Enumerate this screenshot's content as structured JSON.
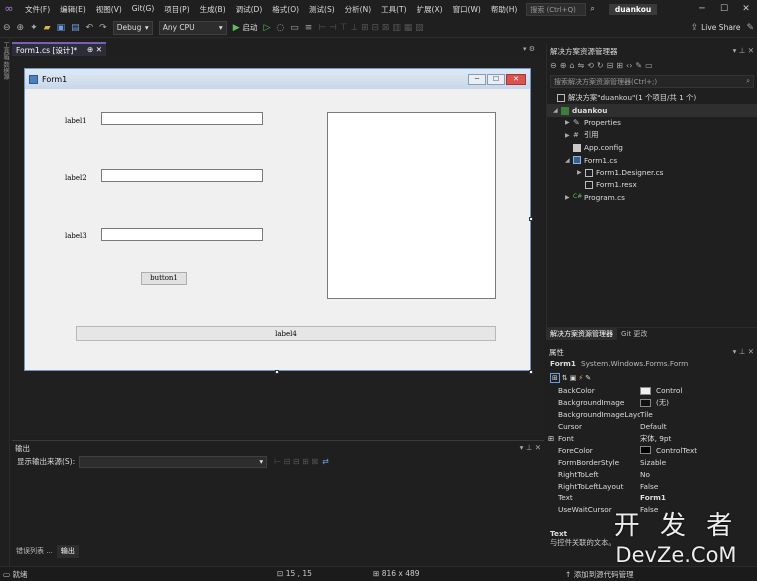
{
  "menu": {
    "items": [
      "文件(F)",
      "编辑(E)",
      "视图(V)",
      "Git(G)",
      "项目(P)",
      "生成(B)",
      "调试(D)",
      "格式(O)",
      "测试(S)",
      "分析(N)",
      "工具(T)",
      "扩展(X)",
      "窗口(W)",
      "帮助(H)"
    ],
    "search_placeholder": "搜索 (Ctrl+Q)",
    "project_name": "duankou"
  },
  "toolbar": {
    "config": "Debug",
    "platform": "Any CPU",
    "start_label": "启动",
    "live_share": "Live Share"
  },
  "doc_tab": {
    "title": "Form1.cs [设计]*",
    "pin": "⊕",
    "close": "✕"
  },
  "form": {
    "title": "Form1",
    "label1": "label1",
    "label2": "label2",
    "label3": "label3",
    "button1": "button1",
    "label4": "label4"
  },
  "output": {
    "title": "输出",
    "source_label": "显示输出来源(S):",
    "tabs": [
      "错误列表 ...",
      "输出"
    ]
  },
  "solution": {
    "title": "解决方案资源管理器",
    "search_placeholder": "搜索解决方案资源管理器(Ctrl+;)",
    "items": [
      "解决方案\"duankou\"(1 个项目/共 1 个)",
      "duankou",
      "Properties",
      "引用",
      "App.config",
      "Form1.cs",
      "Form1.Designer.cs",
      "Form1.resx",
      "Program.cs"
    ],
    "tabs": [
      "解决方案资源管理器",
      "Git 更改"
    ]
  },
  "properties": {
    "title": "属性",
    "object_name": "Form1",
    "object_type": "System.Windows.Forms.Form",
    "rows": [
      {
        "name": "BackColor",
        "value": "Control",
        "swatch": "#f0f0f0"
      },
      {
        "name": "BackgroundImage",
        "value": "(无)",
        "swatch": "#111111"
      },
      {
        "name": "BackgroundImageLayout",
        "value": "Tile"
      },
      {
        "name": "Cursor",
        "value": "Default"
      },
      {
        "name": "Font",
        "value": "宋体, 9pt",
        "expand": "⊞"
      },
      {
        "name": "ForeColor",
        "value": "ControlText",
        "swatch": "#000000"
      },
      {
        "name": "FormBorderStyle",
        "value": "Sizable"
      },
      {
        "name": "RightToLeft",
        "value": "No"
      },
      {
        "name": "RightToLeftLayout",
        "value": "False"
      },
      {
        "name": "Text",
        "value": "Form1",
        "bold": true
      },
      {
        "name": "UseWaitCursor",
        "value": "False"
      }
    ],
    "desc_title": "Text",
    "desc_text": "与控件关联的文本。"
  },
  "status": {
    "ready": "就绪",
    "position": "15 , 15",
    "size": "816 x 489",
    "add_source": "添加到源代码管理"
  },
  "watermark": {
    "line1": "开 发 者",
    "line2": "DevZe.CoM"
  },
  "colors": {
    "accent": "#7a5fb5",
    "form_border": "#6a98c8"
  }
}
